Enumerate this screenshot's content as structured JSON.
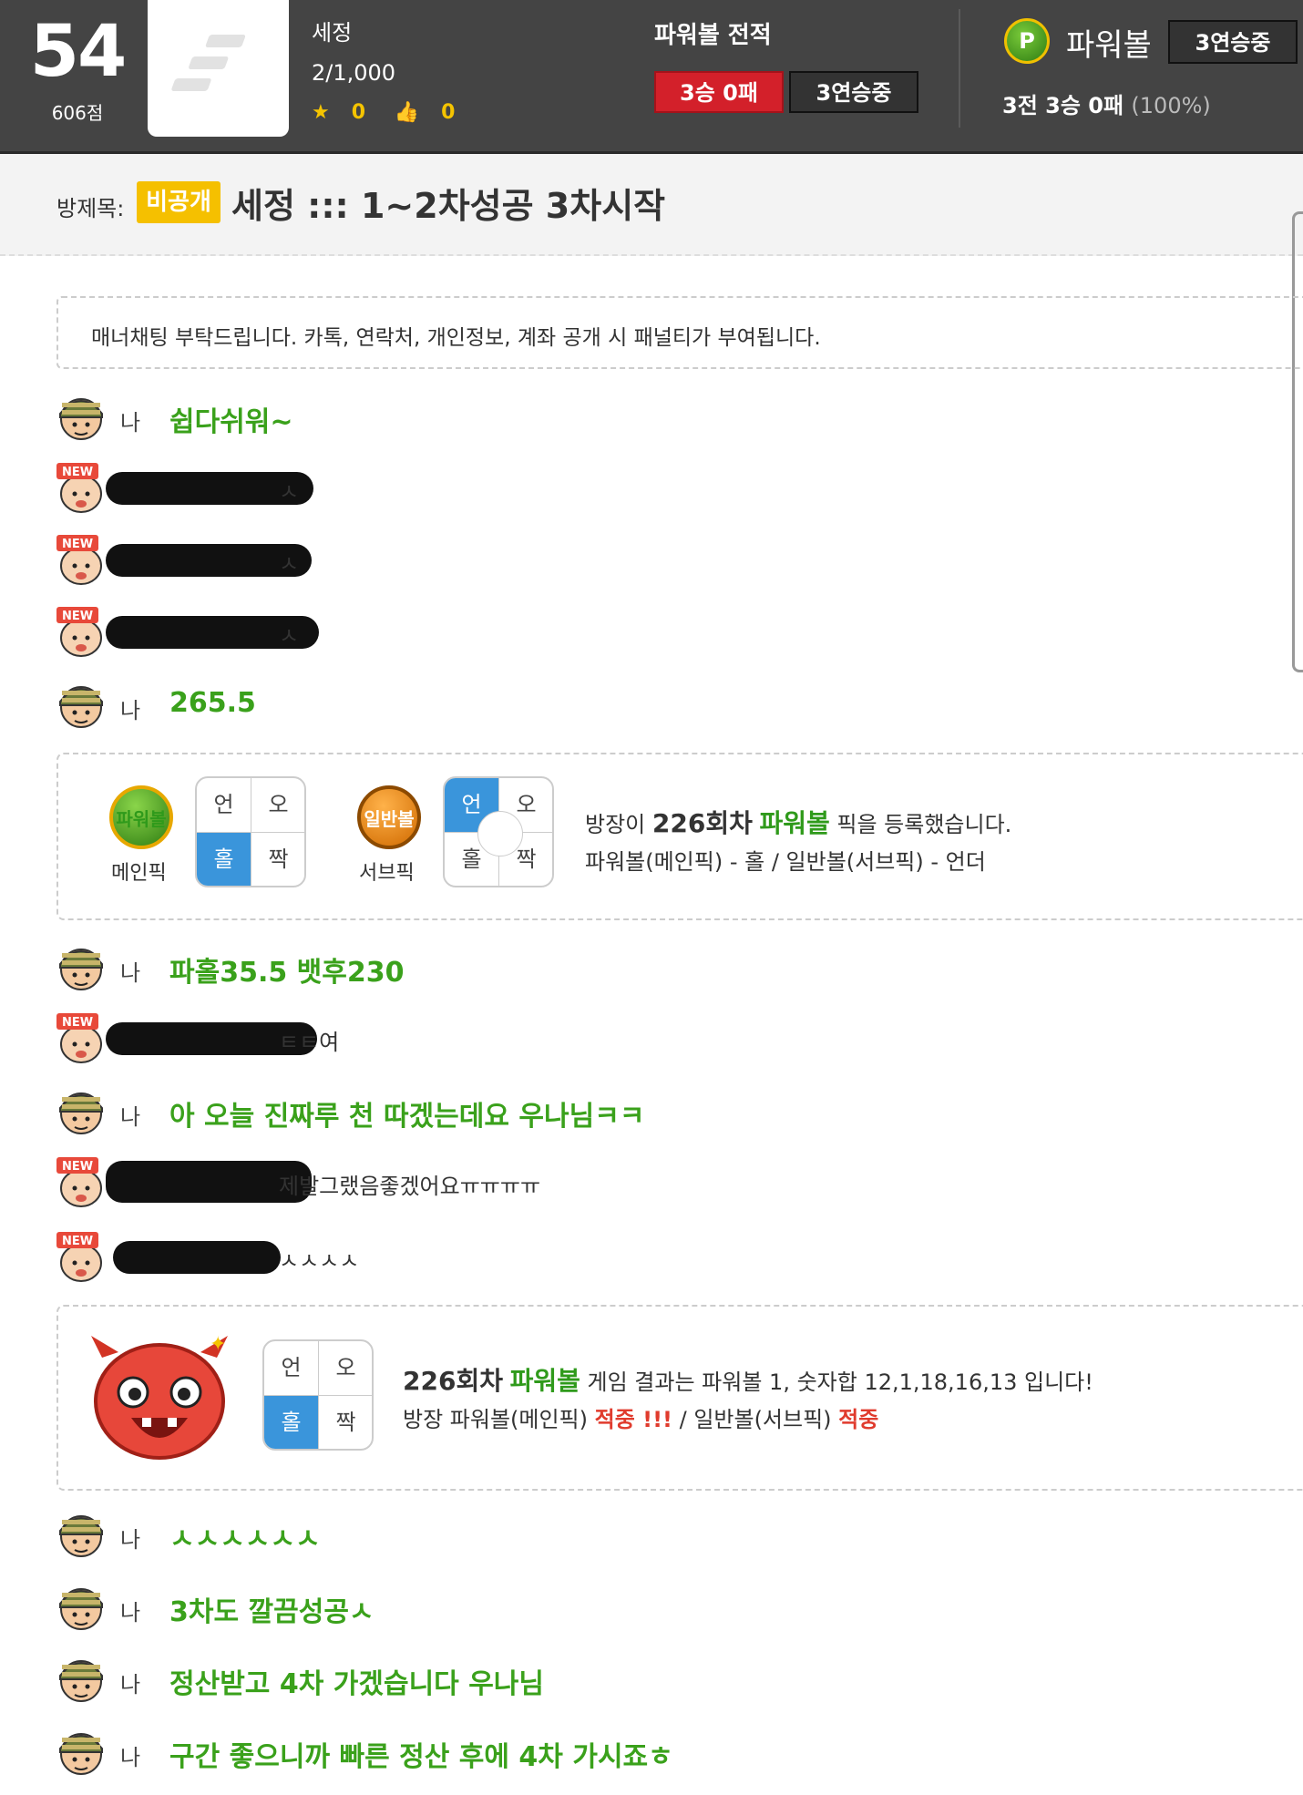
{
  "header": {
    "level": "54",
    "points": "606점",
    "username": "세정",
    "rank": "2/1,000",
    "stars": "0",
    "likes": "0",
    "record_title": "파워볼 전적",
    "record_result": "3승 0패",
    "record_streak": "3연승중",
    "game_icon_letter": "P",
    "game_name": "파워볼",
    "game_streak": "3연승중",
    "game_record": "3전 3승 0패",
    "game_pct": "(100%)"
  },
  "room": {
    "label": "방제목:",
    "badge": "비공개",
    "title": "세정 ::: 1~2차성공 3차시작"
  },
  "notice": "매너채팅 부탁드립니다. 카톡, 연락처, 개인정보, 계좌 공개 시 패널티가 부여됩니다.",
  "me_label": "나",
  "chat": [
    {
      "who": "me",
      "text": "쉽다쉬워~"
    },
    {
      "who": "other",
      "text": "ㅅ"
    },
    {
      "who": "other",
      "text": "ㅅ"
    },
    {
      "who": "other",
      "text": "ㅅ"
    },
    {
      "who": "me",
      "text": "265.5"
    },
    {
      "who": "me",
      "text": "파홀35.5 뱃후230"
    },
    {
      "who": "other",
      "text": "ㅌㅌ여"
    },
    {
      "who": "me",
      "text": "아 오늘 진짜루 천 따겠는데요 우나님ㅋㅋ"
    },
    {
      "who": "other",
      "text": "제발그랬음좋겠어요ㅠㅠㅠㅠ"
    },
    {
      "who": "other",
      "text": "ㅅㅅㅅㅅ"
    },
    {
      "who": "me",
      "text": "ㅅㅅㅅㅅㅅㅅ"
    },
    {
      "who": "me",
      "text": "3차도 깔끔성공ㅅ"
    },
    {
      "who": "me",
      "text": "정산받고 4차 가겠습니다 우나님"
    },
    {
      "who": "me",
      "text": "구간 좋으니까 빠른 정산 후에 4차 가시죠ㅎ"
    }
  ],
  "pick": {
    "main_ball": "파워볼",
    "main_caption": "메인픽",
    "sub_ball": "일반볼",
    "sub_caption": "서브픽",
    "grid": {
      "under": "언",
      "over": "오",
      "odd": "홀",
      "even": "짝"
    },
    "msg_pre": "방장이 ",
    "msg_round": "226회차",
    "msg_game": "파워볼",
    "msg_post": " 픽을 등록했습니다.",
    "msg_line2": "파워볼(메인픽) - 홀 / 일반볼(서브픽) - 언더"
  },
  "result": {
    "round": "226회차",
    "game": "파워볼",
    "line1_post": " 게임 결과는 파워볼 1, 숫자합 12,1,18,16,13 입니다!",
    "line2_a": "방장 파워볼(메인픽) ",
    "hit1": "적중 !!!",
    "line2_b": " / 일반볼(서브픽) ",
    "hit2": "적중"
  },
  "colors": {
    "header_bg": "#444444",
    "green": "#3aa11b",
    "red": "#d3202a",
    "blue": "#3a95db",
    "badge": "#f5c000"
  }
}
